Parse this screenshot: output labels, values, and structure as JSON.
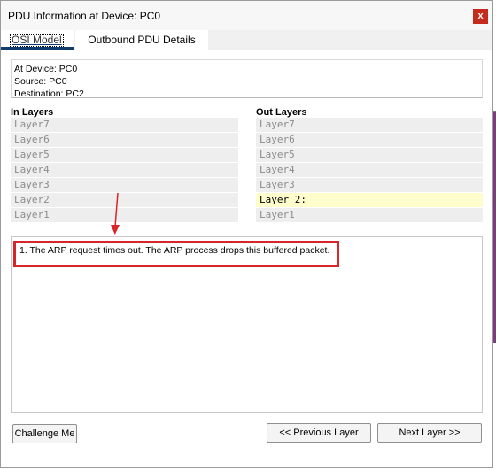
{
  "window": {
    "title": "PDU Information at Device: PC0",
    "close_label": "x"
  },
  "tabs": [
    {
      "label": "OSI Model",
      "selected": true
    },
    {
      "label": "Outbound PDU Details",
      "selected": false
    }
  ],
  "info": {
    "device": "At Device: PC0",
    "source": "Source: PC0",
    "destination": "Destination: PC2"
  },
  "in_layers": {
    "title": "In Layers",
    "items": [
      "Layer7",
      "Layer6",
      "Layer5",
      "Layer4",
      "Layer3",
      "Layer2",
      "Layer1"
    ]
  },
  "out_layers": {
    "title": "Out Layers",
    "items": [
      "Layer7",
      "Layer6",
      "Layer5",
      "Layer4",
      "Layer3",
      "Layer 2:",
      "Layer1"
    ],
    "active_index": 5
  },
  "description": "1. The ARP request times out. The ARP process drops this buffered packet.",
  "buttons": {
    "challenge": "Challenge Me",
    "previous": "<< Previous Layer",
    "next": "Next Layer >>"
  },
  "colors": {
    "highlight": "#d7262a",
    "active_layer": "#fffdcc",
    "tab_accent": "#0e3d6e",
    "close": "#c42b1c"
  }
}
